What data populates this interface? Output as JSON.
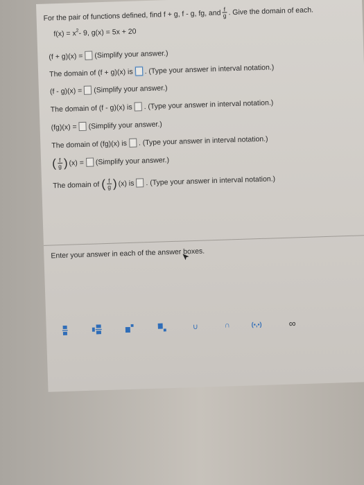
{
  "problem": {
    "instruction_a": "For the pair of functions defined, find f + g, f - g, fg, and",
    "instruction_frac_num": "f",
    "instruction_frac_den": "g",
    "instruction_b": ". Give the domain of each.",
    "functions_a": "f(x) = x",
    "functions_exp": "2",
    "functions_b": " - 9, g(x) = 5x + 20",
    "sum_label": "(f + g)(x) =",
    "sum_hint": "(Simplify your answer.)",
    "sum_domain_label": "The domain of (f + g)(x) is",
    "sum_domain_hint": ". (Type your answer in interval notation.)",
    "diff_label": "(f - g)(x) =",
    "diff_hint": "(Simplify your answer.)",
    "diff_domain_label": "The domain of (f - g)(x) is",
    "diff_domain_hint": ". (Type your answer in interval notation.)",
    "prod_label": "(fg)(x) =",
    "prod_hint": "(Simplify your answer.)",
    "prod_domain_label": "The domain of (fg)(x) is",
    "prod_domain_hint": ". (Type your answer in interval notation.)",
    "quot_frac_num": "f",
    "quot_frac_den": "g",
    "quot_label": "(x) =",
    "quot_hint": "(Simplify your answer.)",
    "quot_domain_label": "The domain of",
    "quot_domain_mid": "(x) is",
    "quot_domain_hint": ". (Type your answer in interval notation.)"
  },
  "footer": {
    "text": "Enter your answer in each of the answer boxes."
  },
  "toolbar": {
    "union": "∪",
    "intersection": "∩",
    "interval": "(▪,▪)",
    "infinity": "∞"
  },
  "colors": {
    "accent": "#2f6db8",
    "active_box": "#3f78b5"
  }
}
